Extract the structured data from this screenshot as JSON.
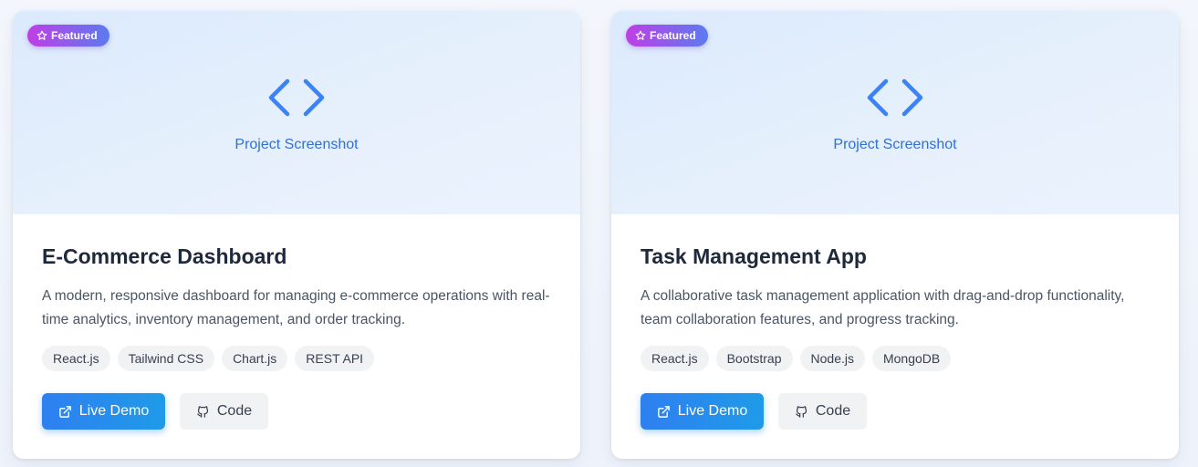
{
  "colors": {
    "accent": "#2f7ff0",
    "badge_gradient_start": "#c03ee6",
    "badge_gradient_end": "#5b7bf0",
    "title": "#1e293b",
    "thumb_label": "#2f6fd8"
  },
  "projects": [
    {
      "badge": "Featured",
      "badge_icon": "star-icon",
      "thumb_icon": "code-brackets-icon",
      "thumb_label": "Project Screenshot",
      "title": "E-Commerce Dashboard",
      "description": "A modern, responsive dashboard for managing e-commerce operations with real-time analytics, inventory management, and order tracking.",
      "tags": [
        "React.js",
        "Tailwind CSS",
        "Chart.js",
        "REST API"
      ],
      "demo_label": "Live Demo",
      "demo_icon": "external-link-icon",
      "code_label": "Code",
      "code_icon": "github-icon"
    },
    {
      "badge": "Featured",
      "badge_icon": "star-icon",
      "thumb_icon": "code-brackets-icon",
      "thumb_label": "Project Screenshot",
      "title": "Task Management App",
      "description": "A collaborative task management application with drag-and-drop functionality, team collaboration features, and progress tracking.",
      "tags": [
        "React.js",
        "Bootstrap",
        "Node.js",
        "MongoDB"
      ],
      "demo_label": "Live Demo",
      "demo_icon": "external-link-icon",
      "code_label": "Code",
      "code_icon": "github-icon"
    }
  ]
}
